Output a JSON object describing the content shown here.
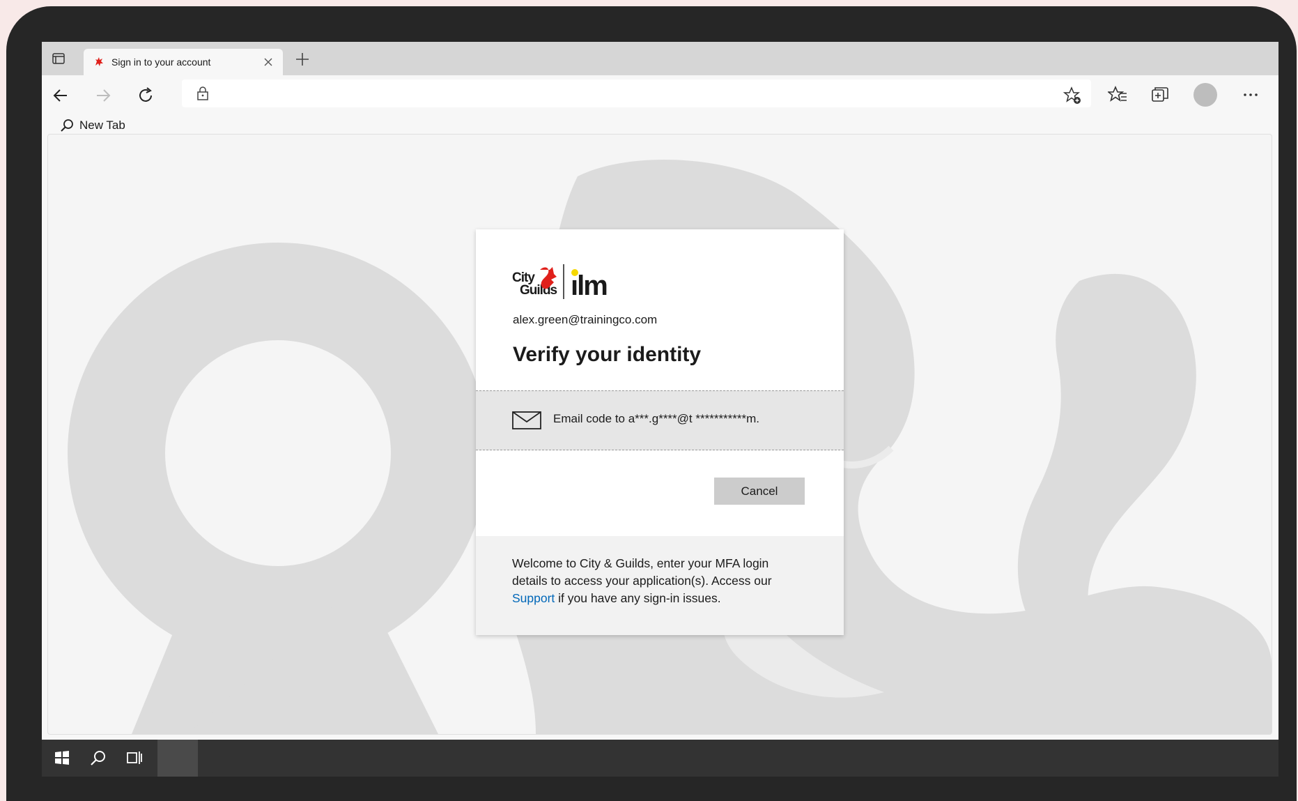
{
  "browser": {
    "tab_title": "Sign in to your account",
    "favorites_bar": {
      "item_label": "New Tab"
    },
    "address": {
      "url": ""
    }
  },
  "signin": {
    "identity": "alex.green@trainingco.com",
    "title": "Verify your identity",
    "option_text": "Email code to a***.g****@t ***********m.",
    "cancel_label": "Cancel",
    "footer": {
      "text_before": "Welcome to City & Guilds, enter your MFA login details to access your application(s). Access our",
      "link_label": "Support",
      "text_after": "if you have any sign-in issues."
    },
    "logo_text": "City & Guilds | ilm"
  },
  "colors": {
    "brand_red": "#e0201b",
    "brand_yellow": "#f5d800",
    "link_blue": "#0067b8",
    "cancel_bg": "#cccccc"
  },
  "icons": [
    "tab-actions-icon",
    "close-icon",
    "plus-icon",
    "back-icon",
    "forward-icon",
    "refresh-icon",
    "lock-icon",
    "add-favorite-icon",
    "favorites-icon",
    "collections-icon",
    "more-icon",
    "search-icon",
    "mail-icon",
    "windows-icon",
    "task-view-icon"
  ]
}
